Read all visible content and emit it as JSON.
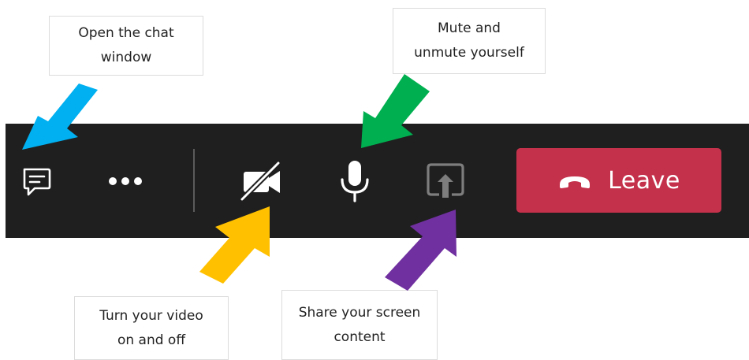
{
  "callouts": {
    "chat": {
      "line1": "Open the chat",
      "line2": "window"
    },
    "mute": {
      "line1": "Mute and",
      "line2": "unmute yourself"
    },
    "video": {
      "line1": "Turn your video",
      "line2": "on and off"
    },
    "share": {
      "line1": "Share your screen",
      "line2": "content"
    }
  },
  "toolbar": {
    "icons": {
      "chat": "chat-icon",
      "more": "more-options-icon",
      "video": "video-off-icon",
      "mic": "microphone-icon",
      "share": "share-screen-icon",
      "leave": "hang-up-icon"
    },
    "leave_label": "Leave"
  },
  "colors": {
    "toolbar_bg": "#1f1f1f",
    "leave_bg": "#c4314b",
    "arrow_chat": "#00b0f0",
    "arrow_mute": "#00b050",
    "arrow_video": "#ffc000",
    "arrow_share": "#7030a0"
  }
}
